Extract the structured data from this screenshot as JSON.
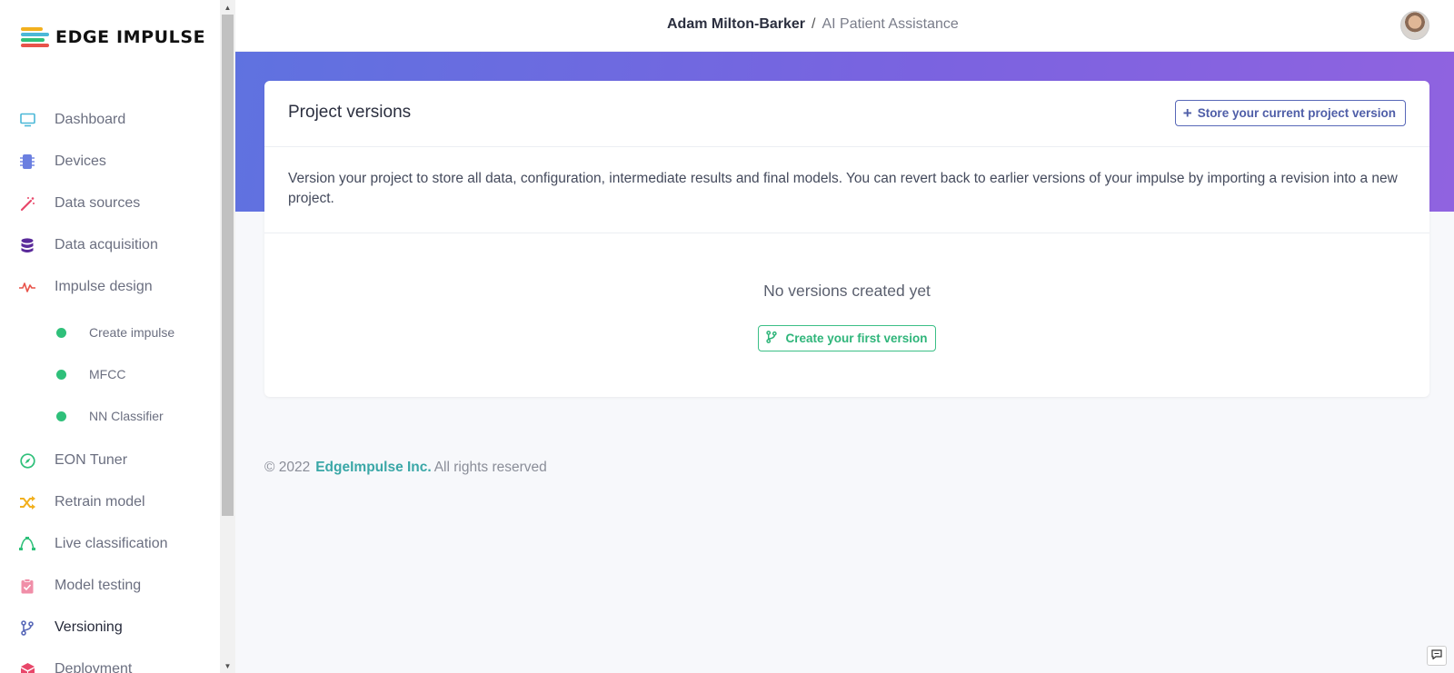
{
  "logo": {
    "text": "EDGE IMPULSE"
  },
  "colors": {
    "accent": "#5868b8",
    "success": "#2fc07a",
    "hero_start": "#5f72e0",
    "hero_end": "#9063e0",
    "company_link": "#3aa7a7"
  },
  "sidebar": {
    "items": [
      {
        "label": "Dashboard",
        "icon": "monitor-icon",
        "color": "#4bb8d8"
      },
      {
        "label": "Devices",
        "icon": "chip-icon",
        "color": "#6b7fe0"
      },
      {
        "label": "Data sources",
        "icon": "magic-wand-icon",
        "color": "#e8476a"
      },
      {
        "label": "Data acquisition",
        "icon": "database-icon",
        "color": "#5a2a9a"
      },
      {
        "label": "Impulse design",
        "icon": "pulse-icon",
        "color": "#e8534a"
      },
      {
        "label": "EON Tuner",
        "icon": "compass-icon",
        "color": "#2fc07a"
      },
      {
        "label": "Retrain model",
        "icon": "shuffle-icon",
        "color": "#f2b01e"
      },
      {
        "label": "Live classification",
        "icon": "curve-icon",
        "color": "#2fc07a"
      },
      {
        "label": "Model testing",
        "icon": "clipboard-check-icon",
        "color": "#f08ea8"
      },
      {
        "label": "Versioning",
        "icon": "branch-icon",
        "color": "#5868b8",
        "active": true
      },
      {
        "label": "Deployment",
        "icon": "box-icon",
        "color": "#e8476a"
      }
    ],
    "sub_items": [
      {
        "label": "Create impulse"
      },
      {
        "label": "MFCC"
      },
      {
        "label": "NN Classifier"
      }
    ]
  },
  "header": {
    "user": "Adam Milton-Barker",
    "separator": "/",
    "project": "AI Patient Assistance"
  },
  "card": {
    "title": "Project versions",
    "store_button": "Store your current project version",
    "description": "Version your project to store all data, configuration, intermediate results and final models. You can revert back to earlier versions of your impulse by importing a revision into a new project.",
    "empty_text": "No versions created yet",
    "create_button": "Create your first version"
  },
  "footer": {
    "copyright": "© 2022",
    "company": "EdgeImpulse Inc.",
    "rights": "All rights reserved"
  }
}
